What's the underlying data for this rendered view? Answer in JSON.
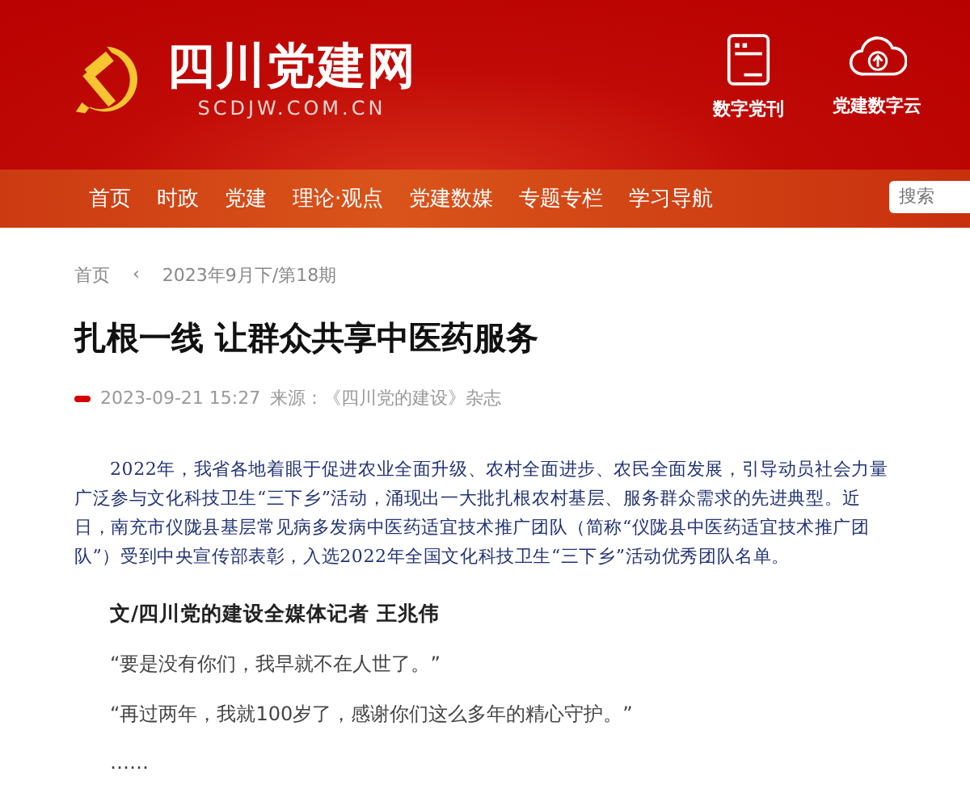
{
  "header": {
    "site_name": "四川党建网",
    "site_url": "SCDJW.COM.CN",
    "links": [
      {
        "kind": "magazine",
        "label": "数字党刊"
      },
      {
        "kind": "cloud",
        "label": "党建数字云"
      }
    ]
  },
  "nav": {
    "items": [
      "首页",
      "时政",
      "党建",
      "理论·观点",
      "党建数媒",
      "专题专栏",
      "学习导航"
    ],
    "search": {
      "placeholder": "搜索"
    }
  },
  "breadcrumb": [
    "首页",
    "‹",
    "2023年9月下/第18期"
  ],
  "article": {
    "title": "扎根一线 让群众共享中医药服务",
    "date": "2023-09-21 15:27",
    "source": "来源：《四川党的建设》杂志",
    "lead": "2022年，我省各地着眼于促进农业全面升级、农村全面进步、农民全面发展，引导动员社会力量广泛参与文化科技卫生“三下乡”活动，涌现出一大批扎根农村基层、服务群众需求的先进典型。近日，南充市仪陇县基层常见病多发病中医药适宜技术推广团队（简称“仪陇县中医药适宜技术推广团队”）受到中央宣传部表彰，入选2022年全国文化科技卫生“三下乡”活动优秀团队名单。",
    "byline": "文/四川党的建设全媒体记者 王兆伟",
    "paragraphs": [
      "“要是没有你们，我早就不在人世了。”",
      "“再过两年，我就100岁了，感谢你们这么多年的精心守护。”",
      "……"
    ]
  }
}
